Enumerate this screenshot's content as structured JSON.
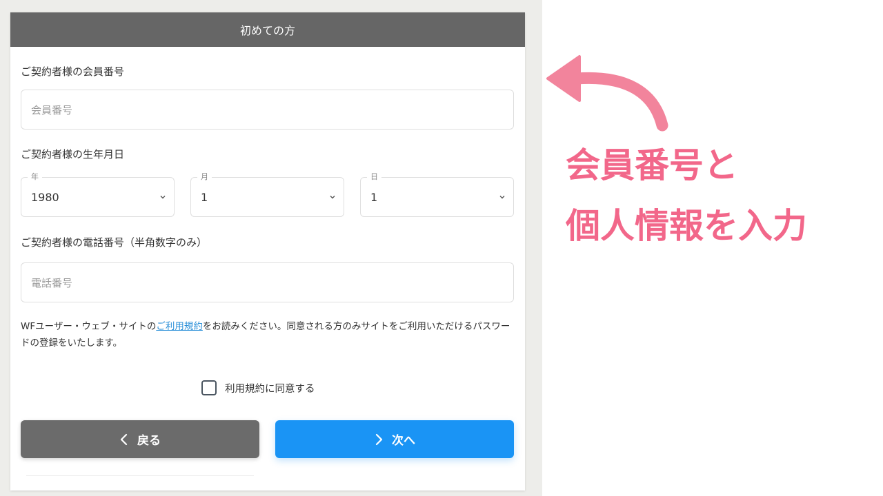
{
  "card": {
    "header_title": "初めての方",
    "member_label": "ご契約者様の会員番号",
    "member_placeholder": "会員番号",
    "birth_label": "ご契約者様の生年月日",
    "birth": {
      "year_label": "年",
      "year_value": "1980",
      "month_label": "月",
      "month_value": "1",
      "day_label": "日",
      "day_value": "1"
    },
    "phone_label": "ご契約者様の電話番号（半角数字のみ）",
    "phone_placeholder": "電話番号",
    "notice": {
      "prefix": "WFユーザー・ウェブ・サイトの",
      "link": "ご利用規約",
      "suffix": "をお読みください。同意される方のみサイトをご利用いただけるパスワードの登録をいたします。"
    },
    "agree_label": "利用規約に同意する",
    "back_button": "戻る",
    "next_button": "次へ"
  },
  "annotation": {
    "line1": "会員番号と",
    "line2": "個人情報を入力"
  },
  "colors": {
    "header_bg": "#666666",
    "back_button": "#6b6b6b",
    "next_button": "#1a94f5",
    "link": "#2a8fd8",
    "annotation": "#f2678a"
  },
  "icons": [
    "chevron-down-icon",
    "chevron-left-icon",
    "chevron-right-icon",
    "curved-arrow-icon"
  ]
}
